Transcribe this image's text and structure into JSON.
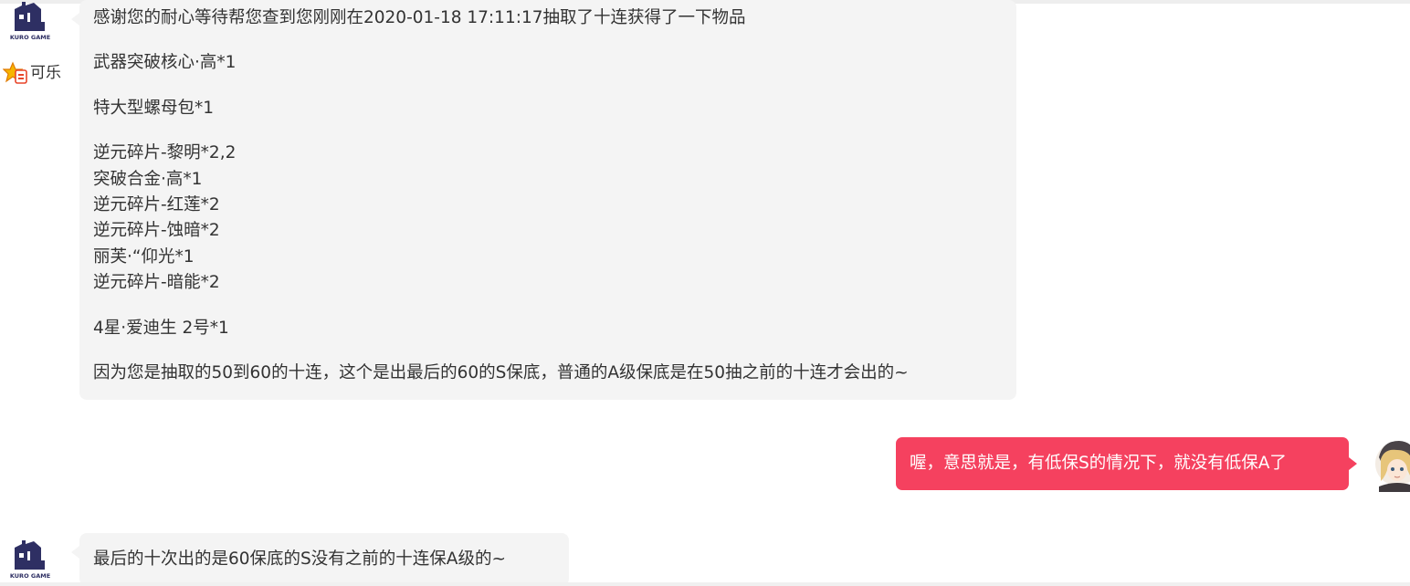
{
  "colors": {
    "page_bg": "#ffffff",
    "agent_bubble_bg": "#f4f4f4",
    "agent_text": "#333333",
    "user_bubble_bg": "#f5415f",
    "user_text": "#ffffff",
    "logo_color": "#2e2f63"
  },
  "agent": {
    "name": "可乐",
    "logo_text": "KURO GAME",
    "name_badge_icon": "gold-crown-badge-icon"
  },
  "messages": [
    {
      "sender": "agent",
      "paragraphs": [
        [
          "感谢您的耐心等待帮您查到您刚刚在2020-01-18 17:11:17抽取了十连获得了一下物品"
        ],
        [
          "武器突破核心·高*1"
        ],
        [
          "特大型螺母包*1"
        ],
        [
          "逆元碎片-黎明*2,2",
          "突破合金·高*1",
          "逆元碎片-红莲*2",
          "逆元碎片-蚀暗*2",
          "丽芙·“仰光*1",
          "逆元碎片-暗能*2"
        ],
        [
          "4星·爱迪生 2号*1"
        ],
        [
          "因为您是抽取的50到60的十连，这个是出最后的60的S保底，普通的A级保底是在50抽之前的十连才会出的~"
        ]
      ]
    },
    {
      "sender": "user",
      "text": "喔，意思就是，有低保S的情况下，就没有低保A了",
      "avatar_icon": "anime-girl-avatar-icon"
    },
    {
      "sender": "agent",
      "paragraphs": [
        [
          "最后的十次出的是60保底的S没有之前的十连保A级的~"
        ]
      ]
    }
  ]
}
